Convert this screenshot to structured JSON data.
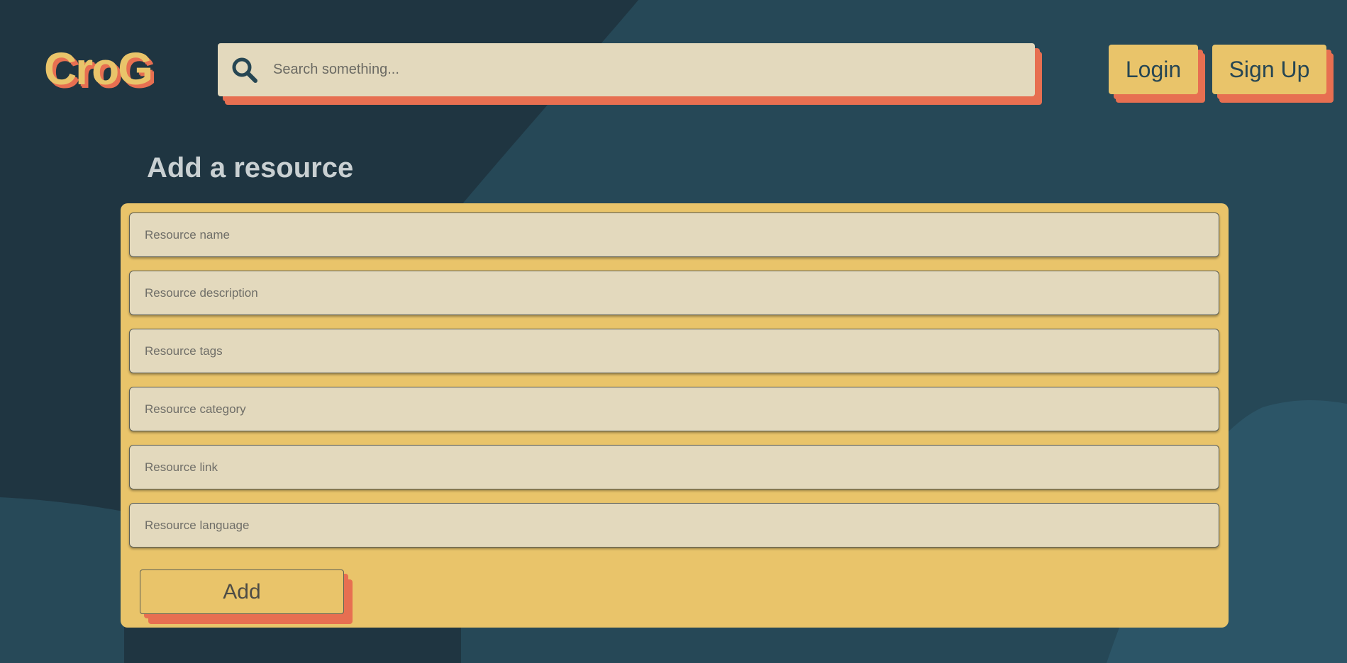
{
  "app": {
    "logo_text": "CroG"
  },
  "header": {
    "search": {
      "placeholder": "Search something...",
      "value": ""
    },
    "login_label": "Login",
    "signup_label": "Sign Up"
  },
  "form": {
    "title": "Add a resource",
    "fields": [
      {
        "placeholder": "Resource name",
        "value": ""
      },
      {
        "placeholder": "Resource description",
        "value": ""
      },
      {
        "placeholder": "Resource tags",
        "value": ""
      },
      {
        "placeholder": "Resource category",
        "value": ""
      },
      {
        "placeholder": "Resource link",
        "value": ""
      },
      {
        "placeholder": "Resource language",
        "value": ""
      }
    ],
    "submit_label": "Add"
  },
  "colors": {
    "background_dark": "#1f3541",
    "background_shape": "#264653",
    "accent_yellow": "#e9c46a",
    "accent_orange": "#e76f51",
    "input_bg": "#e3d9bd"
  },
  "icons": {
    "search": "search-icon"
  }
}
